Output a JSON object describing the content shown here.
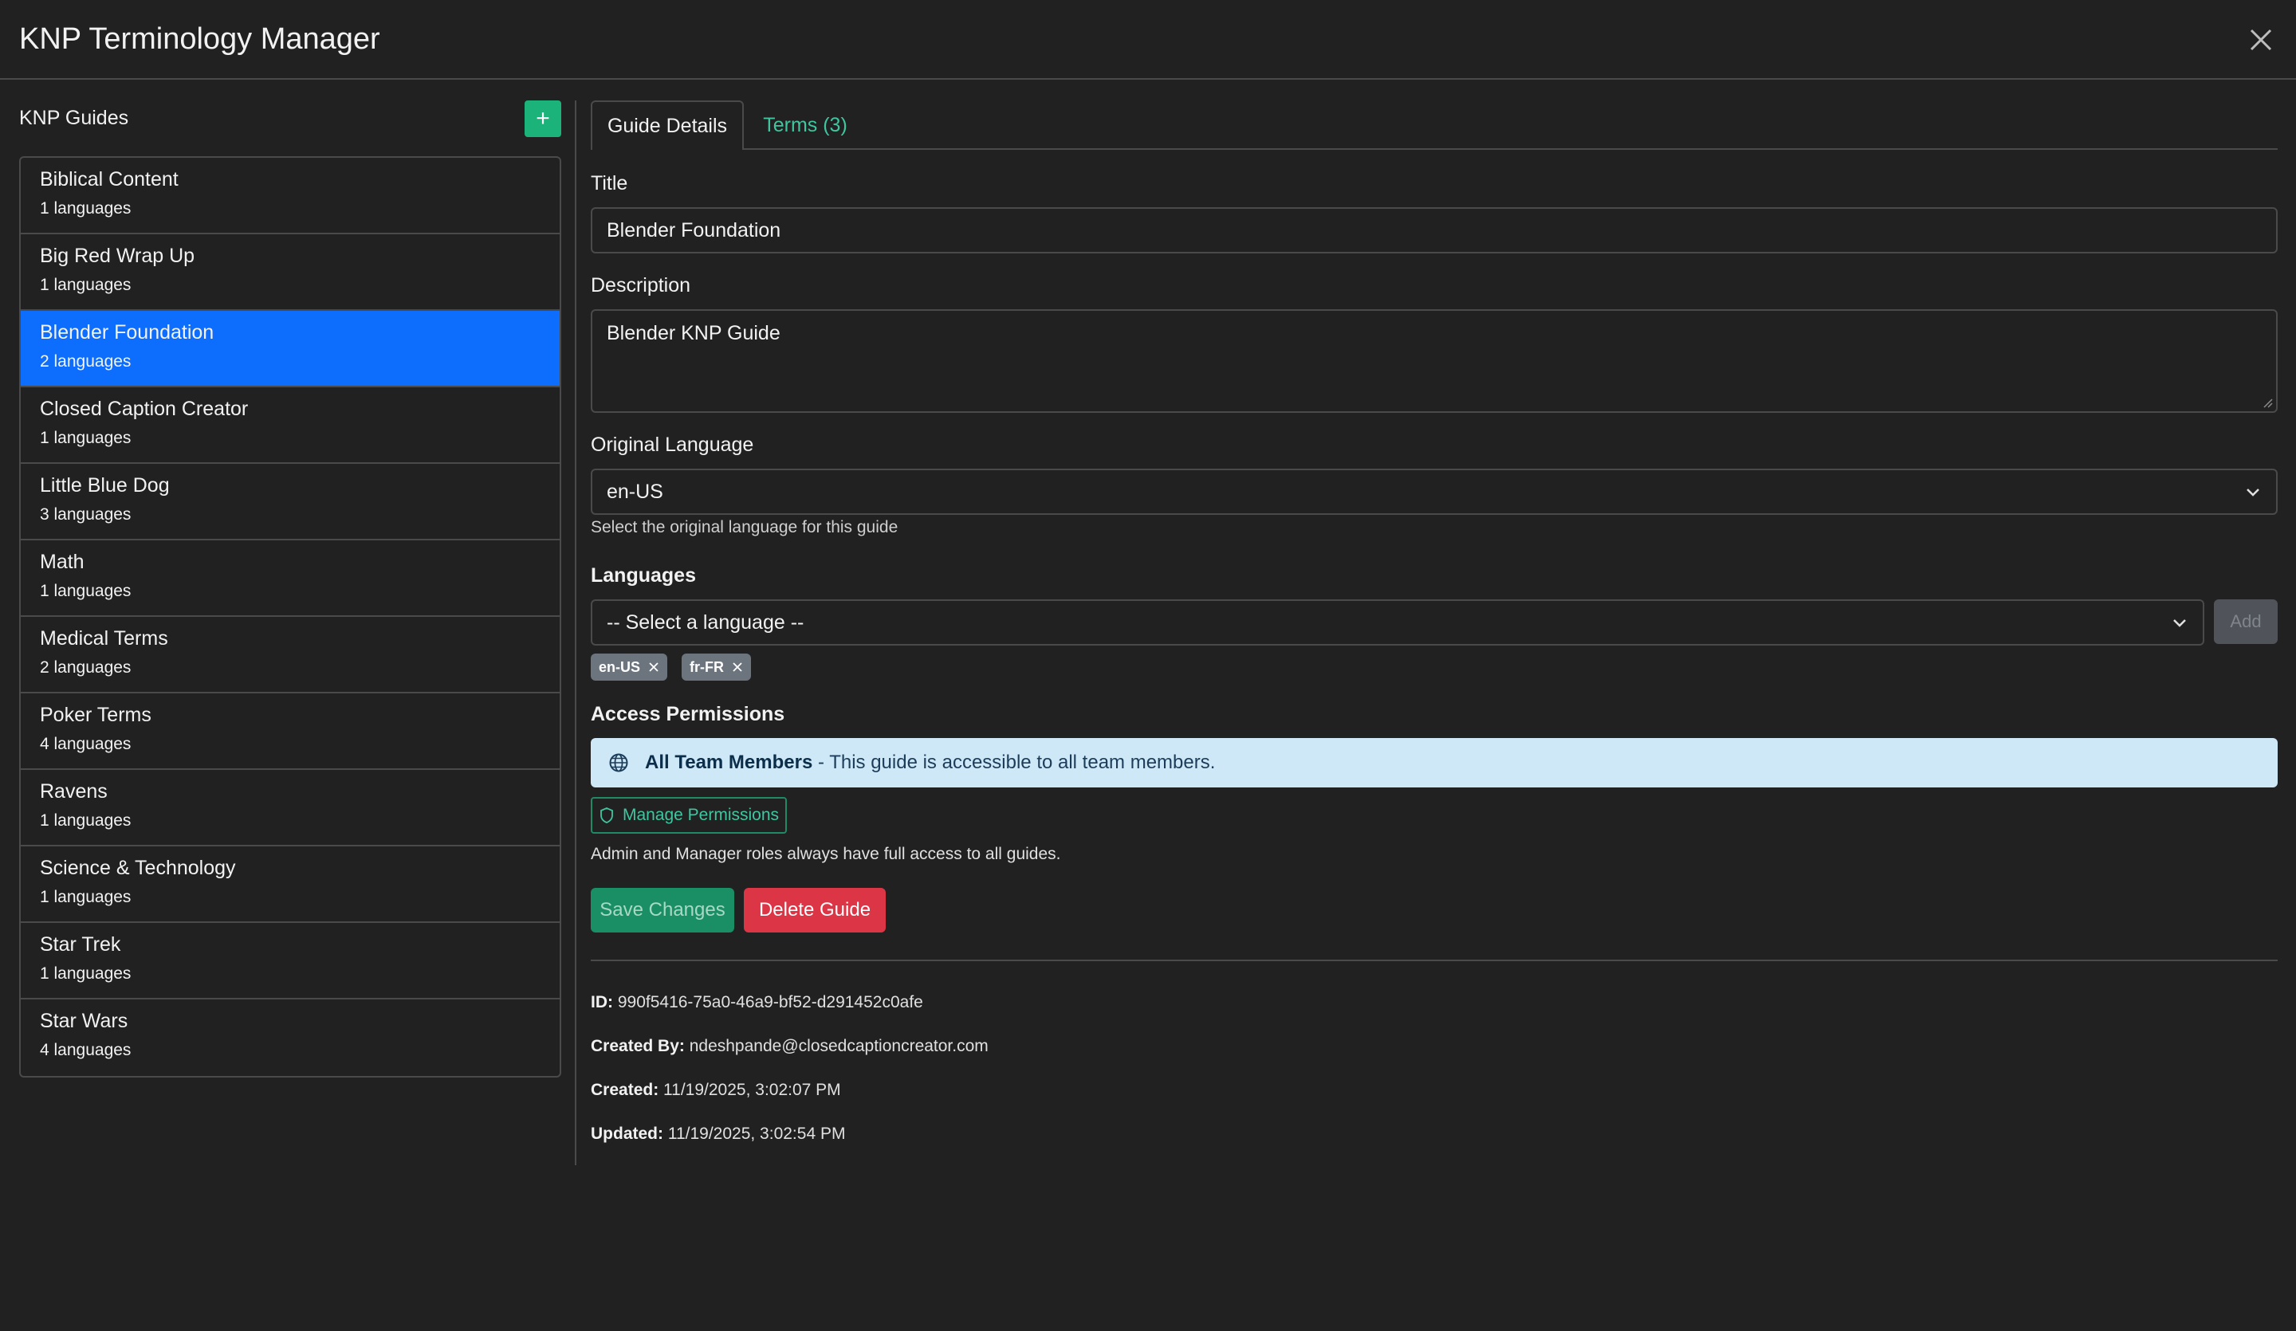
{
  "app": {
    "title": "KNP Terminology Manager"
  },
  "sidebar": {
    "title": "KNP Guides",
    "add_label": "+",
    "guides": [
      {
        "name": "Biblical Content",
        "langs": "1 languages"
      },
      {
        "name": "Big Red Wrap Up",
        "langs": "1 languages"
      },
      {
        "name": "Blender Foundation",
        "langs": "2 languages",
        "active": true
      },
      {
        "name": "Closed Caption Creator",
        "langs": "1 languages"
      },
      {
        "name": "Little Blue Dog",
        "langs": "3 languages"
      },
      {
        "name": "Math",
        "langs": "1 languages"
      },
      {
        "name": "Medical Terms",
        "langs": "2 languages"
      },
      {
        "name": "Poker Terms",
        "langs": "4 languages"
      },
      {
        "name": "Ravens",
        "langs": "1 languages"
      },
      {
        "name": "Science & Technology",
        "langs": "1 languages"
      },
      {
        "name": "Star Trek",
        "langs": "1 languages"
      },
      {
        "name": "Star Wars",
        "langs": "4 languages"
      }
    ]
  },
  "tabs": {
    "details": "Guide Details",
    "terms": "Terms (3)"
  },
  "form": {
    "title_label": "Title",
    "title_value": "Blender Foundation",
    "description_label": "Description",
    "description_value": "Blender KNP Guide",
    "original_language_label": "Original Language",
    "original_language_value": "en-US",
    "original_language_help": "Select the original language for this guide",
    "languages_label": "Languages",
    "language_select_placeholder": "-- Select a language --",
    "add_label": "Add",
    "chips": [
      "en-US",
      "fr-FR"
    ]
  },
  "permissions": {
    "label": "Access Permissions",
    "alert_bold": "All Team Members",
    "alert_text": " - This guide is accessible to all team members.",
    "manage_label": "Manage Permissions",
    "note": "Admin and Manager roles always have full access to all guides."
  },
  "actions": {
    "save": "Save Changes",
    "delete": "Delete Guide"
  },
  "meta": {
    "id_label": "ID:",
    "id_value": "990f5416-75a0-46a9-bf52-d291452c0afe",
    "created_by_label": "Created By:",
    "created_by_value": "ndeshpande@closedcaptioncreator.com",
    "created_label": "Created:",
    "created_value": "11/19/2025, 3:02:07 PM",
    "updated_label": "Updated:",
    "updated_value": "11/19/2025, 3:02:54 PM"
  },
  "colors": {
    "accent": "#1cb37a",
    "active": "#0d6efd",
    "danger": "#dc3545",
    "info_bg": "#cfe8f7"
  }
}
